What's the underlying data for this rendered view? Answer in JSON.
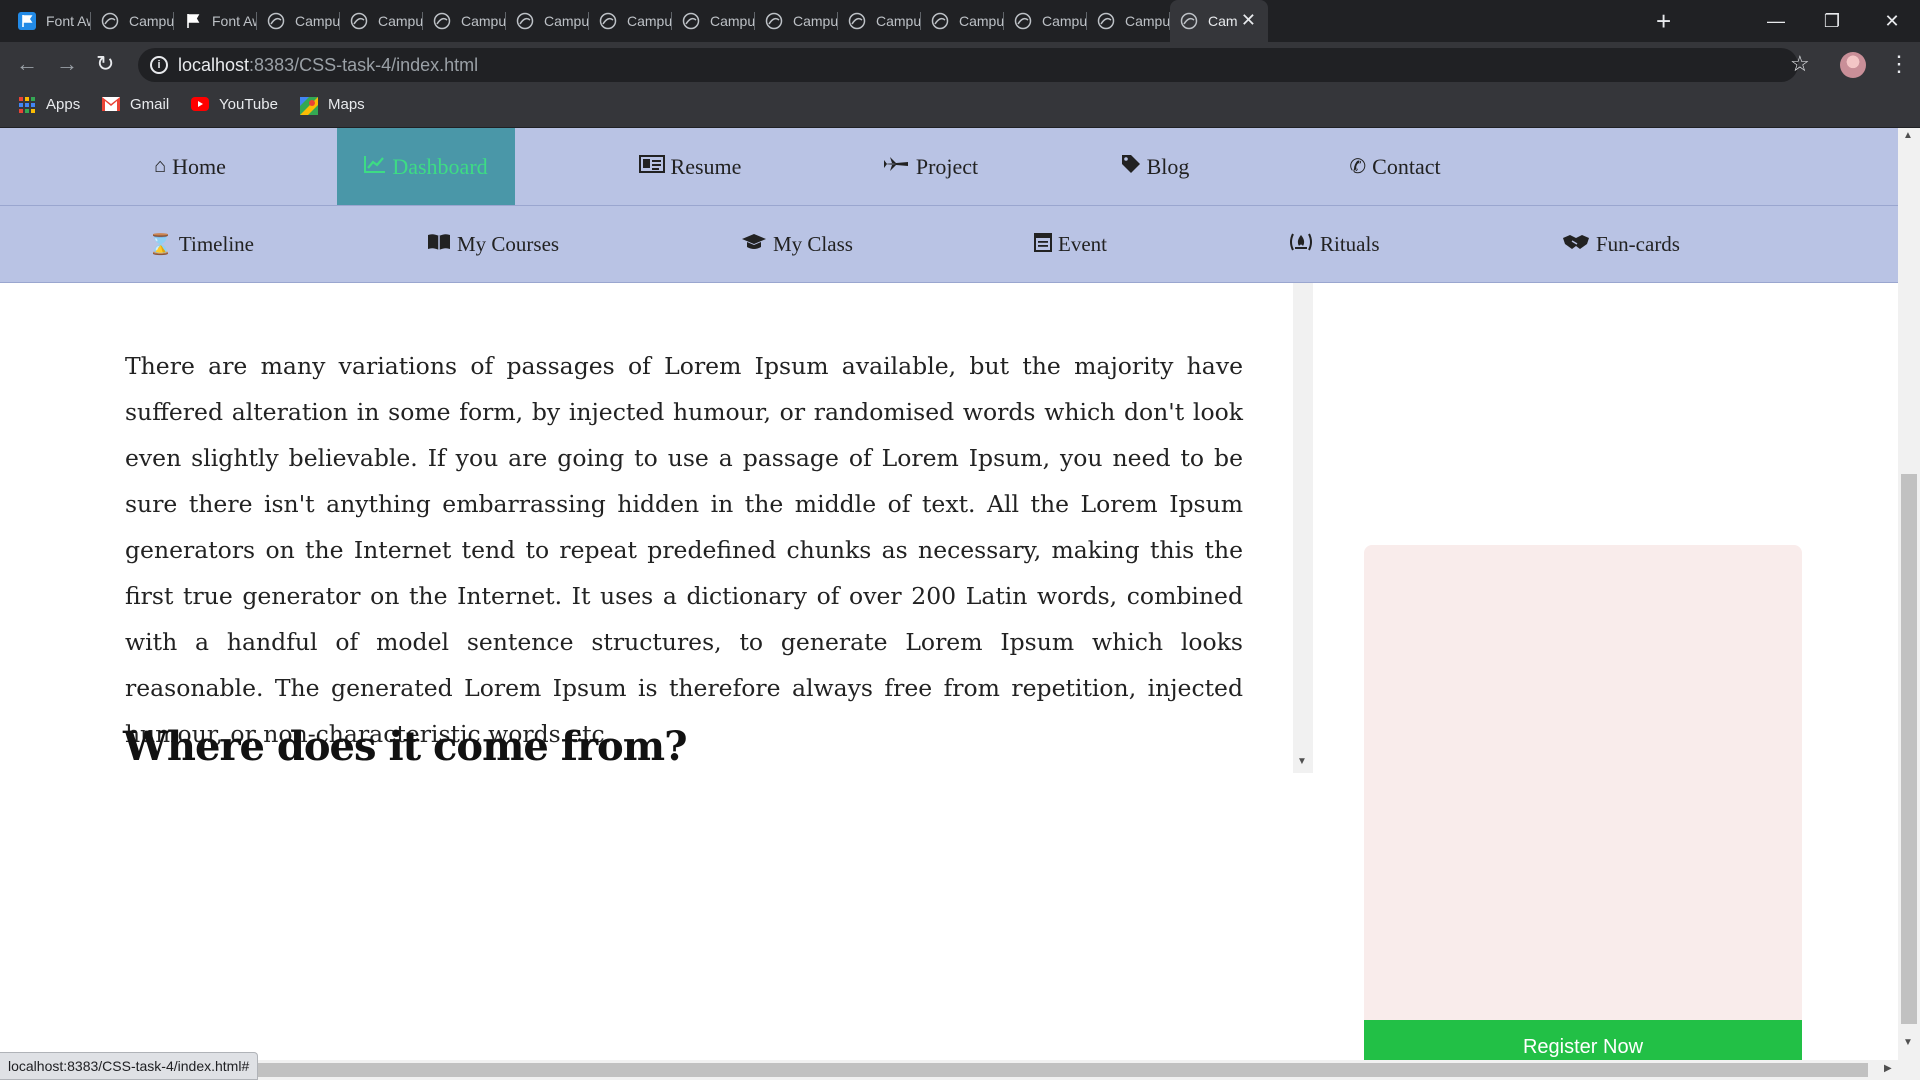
{
  "browser": {
    "tabs": [
      {
        "title": "Font Aw",
        "icon": "flag-icon-blue",
        "active": false
      },
      {
        "title": "Campus",
        "icon": "globe-icon",
        "active": false
      },
      {
        "title": "Font Aw",
        "icon": "flag-icon-black",
        "active": false
      },
      {
        "title": "Campus",
        "icon": "globe-icon",
        "active": false
      },
      {
        "title": "Campus",
        "icon": "globe-icon",
        "active": false
      },
      {
        "title": "Campus",
        "icon": "globe-icon",
        "active": false
      },
      {
        "title": "Campus",
        "icon": "globe-icon",
        "active": false
      },
      {
        "title": "Campus",
        "icon": "globe-icon",
        "active": false
      },
      {
        "title": "Campus",
        "icon": "globe-icon",
        "active": false
      },
      {
        "title": "Campus",
        "icon": "globe-icon",
        "active": false
      },
      {
        "title": "Campus",
        "icon": "globe-icon",
        "active": false
      },
      {
        "title": "Campus",
        "icon": "globe-icon",
        "active": false
      },
      {
        "title": "Campus",
        "icon": "globe-icon",
        "active": false
      },
      {
        "title": "Campus",
        "icon": "globe-icon",
        "active": false
      },
      {
        "title": "Cam",
        "icon": "globe-icon",
        "active": true
      }
    ],
    "new_tab": "+",
    "url_host": "localhost",
    "url_rest": ":8383/CSS-task-4/index.html",
    "bookmarks": [
      {
        "label": "Apps",
        "icon": "apps-grid-icon"
      },
      {
        "label": "Gmail",
        "icon": "gmail-icon"
      },
      {
        "label": "YouTube",
        "icon": "youtube-icon"
      },
      {
        "label": "Maps",
        "icon": "maps-icon"
      }
    ],
    "status_url": "localhost:8383/CSS-task-4/index.html#"
  },
  "nav_primary": [
    {
      "label": "Home",
      "icon": "home-icon",
      "active": false
    },
    {
      "label": "Dashboard",
      "icon": "line-chart-icon",
      "active": true
    },
    {
      "label": "Resume",
      "icon": "id-card-icon",
      "active": false
    },
    {
      "label": "Project",
      "icon": "plane-icon",
      "active": false
    },
    {
      "label": "Blog",
      "icon": "tag-icon",
      "active": false
    },
    {
      "label": "Contact",
      "icon": "phone-volume-icon",
      "active": false
    }
  ],
  "nav_secondary": [
    {
      "label": "Timeline",
      "icon": "hourglass-icon"
    },
    {
      "label": "My Courses",
      "icon": "open-book-icon"
    },
    {
      "label": "My Class",
      "icon": "graduation-cap-icon"
    },
    {
      "label": "Event",
      "icon": "calendar-list-icon"
    },
    {
      "label": "Rituals",
      "icon": "campfire-icon"
    },
    {
      "label": "Fun-cards",
      "icon": "handshake-icon"
    }
  ],
  "main": {
    "paragraph": "There are many variations of passages of Lorem Ipsum available, but the majority have suffered alteration in some form, by injected humour, or randomised words which don't look even slightly believable. If you are going to use a passage of Lorem Ipsum, you need to be sure there isn't anything embarrassing hidden in the middle of text. All the Lorem Ipsum generators on the Internet tend to repeat predefined chunks as necessary, making this the first true generator on the Internet. It uses a dictionary of over 200 Latin words, combined with a handful of model sentence structures, to generate Lorem Ipsum which looks reasonable. The generated Lorem Ipsum is therefore always free from repetition, injected humour, or non-characteristic words etc.",
    "heading": "Where does it come from?"
  },
  "sidebar": {
    "register_label": "Register Now"
  },
  "colors": {
    "nav_bg": "#b9c3e4",
    "nav_active_bg": "#4a97a8",
    "nav_active_text": "#3ddc84",
    "card_bg": "#f9eceb",
    "register_bg": "#22c046"
  }
}
